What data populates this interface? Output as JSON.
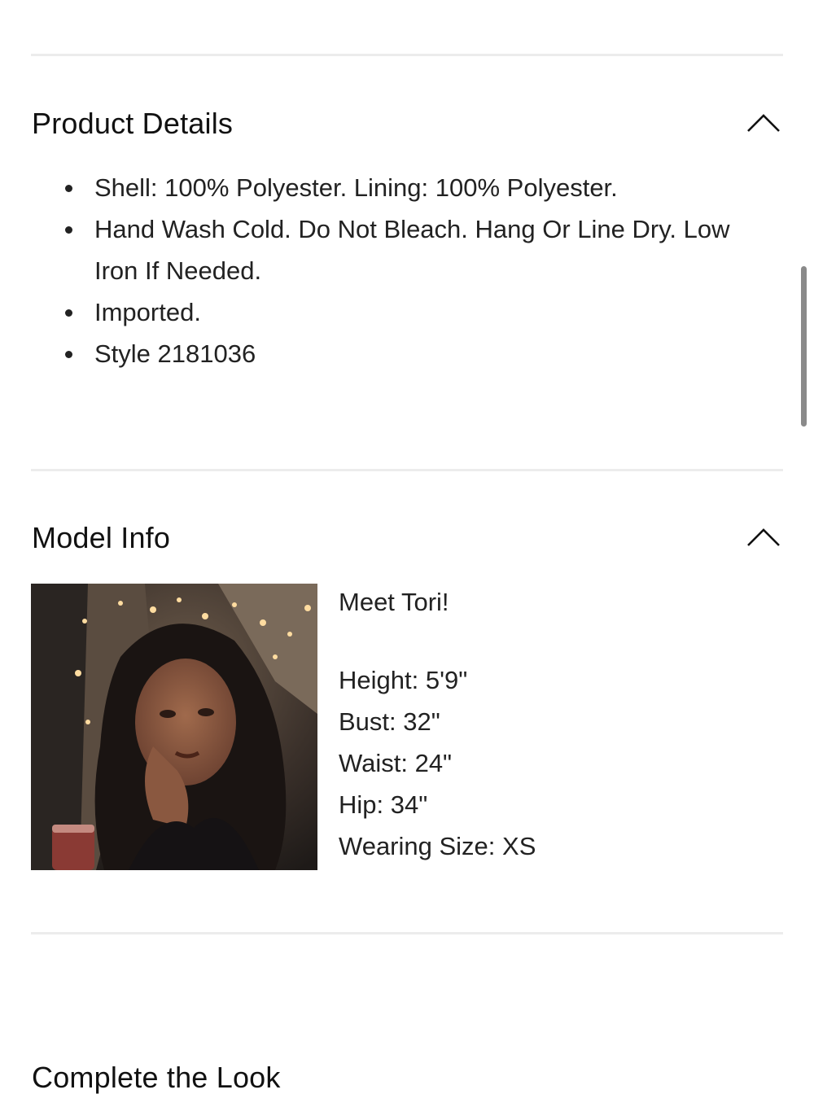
{
  "product_details": {
    "title": "Product Details",
    "items": [
      "Shell: 100% Polyester. Lining: 100% Polyester.",
      "Hand Wash Cold. Do Not Bleach. Hang Or Line Dry. Low Iron If Needed.",
      "Imported.",
      "Style 2181036"
    ],
    "toggle_icon": "chevron-up-icon"
  },
  "model_info": {
    "title": "Model Info",
    "toggle_icon": "chevron-up-icon",
    "intro": "Meet Tori!",
    "stats": [
      "Height: 5'9\"",
      "Bust: 32\"",
      "Waist: 24\"",
      "Hip: 34\"",
      "Wearing Size: XS"
    ]
  },
  "complete_look": {
    "title": "Complete the Look"
  }
}
